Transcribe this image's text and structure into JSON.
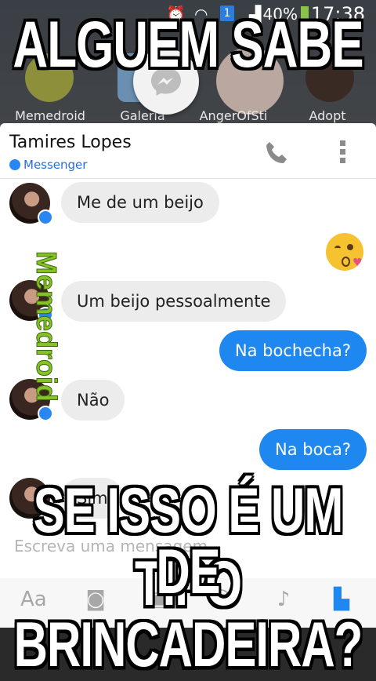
{
  "status_bar": {
    "notification_count": "1",
    "battery": "40%",
    "time": "17:38"
  },
  "home_labels": [
    "Memedroid",
    "Galeria",
    "AngerOfSti",
    "Adopt"
  ],
  "chat": {
    "contact_name": "Tamires Lopes",
    "platform_label": "Messenger",
    "messages": [
      {
        "from": "them",
        "text": "Me de um beijo"
      },
      {
        "from": "me",
        "type": "emoji",
        "icon": "kissing-face-emoji"
      },
      {
        "from": "them",
        "text": "Um beijo pessoalmente"
      },
      {
        "from": "me",
        "text": "Na bochecha?"
      },
      {
        "from": "them",
        "text": "Não"
      },
      {
        "from": "me",
        "text": "Na boca?"
      },
      {
        "from": "them",
        "text": "Sim"
      }
    ],
    "compose_placeholder": "Escreva uma mensagem"
  },
  "watermark": "Memedroid",
  "meme": {
    "top_text": "ALGUEM SABE",
    "bottom_line1": "SE ISSO É UM TIPO",
    "bottom_line2": "DE BRINCADEIRA?"
  },
  "colors": {
    "accent": "#1e88f0",
    "incoming_bubble": "#ececec",
    "watermark": "#86c128"
  }
}
